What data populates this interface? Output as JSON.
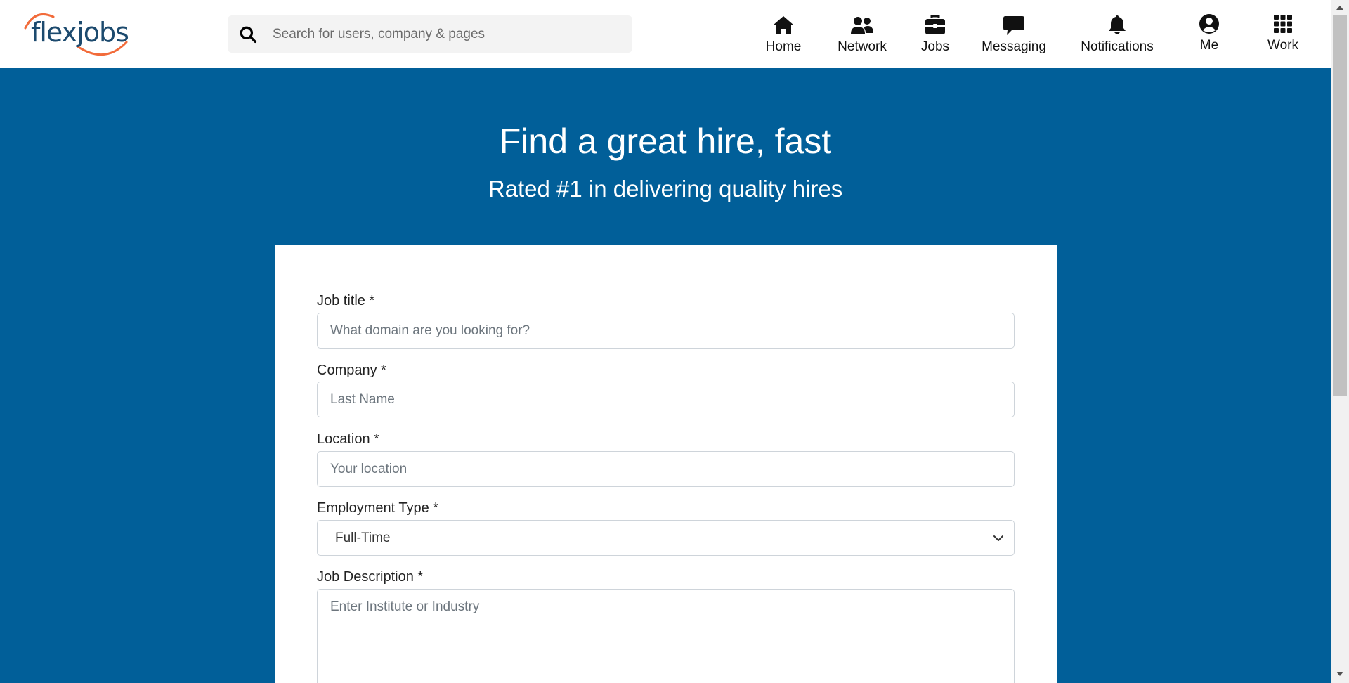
{
  "brand": {
    "name": "flexjobs",
    "accent": "#f26b3a",
    "text_color": "#1c4a6e"
  },
  "search": {
    "placeholder": "Search for users, company & pages"
  },
  "nav": {
    "home": "Home",
    "network": "Network",
    "jobs": "Jobs",
    "messaging": "Messaging",
    "notifications": "Notifications",
    "me": "Me",
    "work": "Work"
  },
  "hero": {
    "title": "Find a great hire, fast",
    "subtitle": "Rated #1 in delivering quality hires",
    "background": "#015f99"
  },
  "form": {
    "job_title": {
      "label": "Job title *",
      "placeholder": "What domain are you looking for?"
    },
    "company": {
      "label": "Company *",
      "placeholder": "Last Name"
    },
    "location": {
      "label": "Location *",
      "placeholder": "Your location"
    },
    "employment_type": {
      "label": "Employment Type *",
      "value": "Full-Time"
    },
    "job_description": {
      "label": "Job Description *",
      "placeholder": "Enter Institute or Industry"
    }
  }
}
